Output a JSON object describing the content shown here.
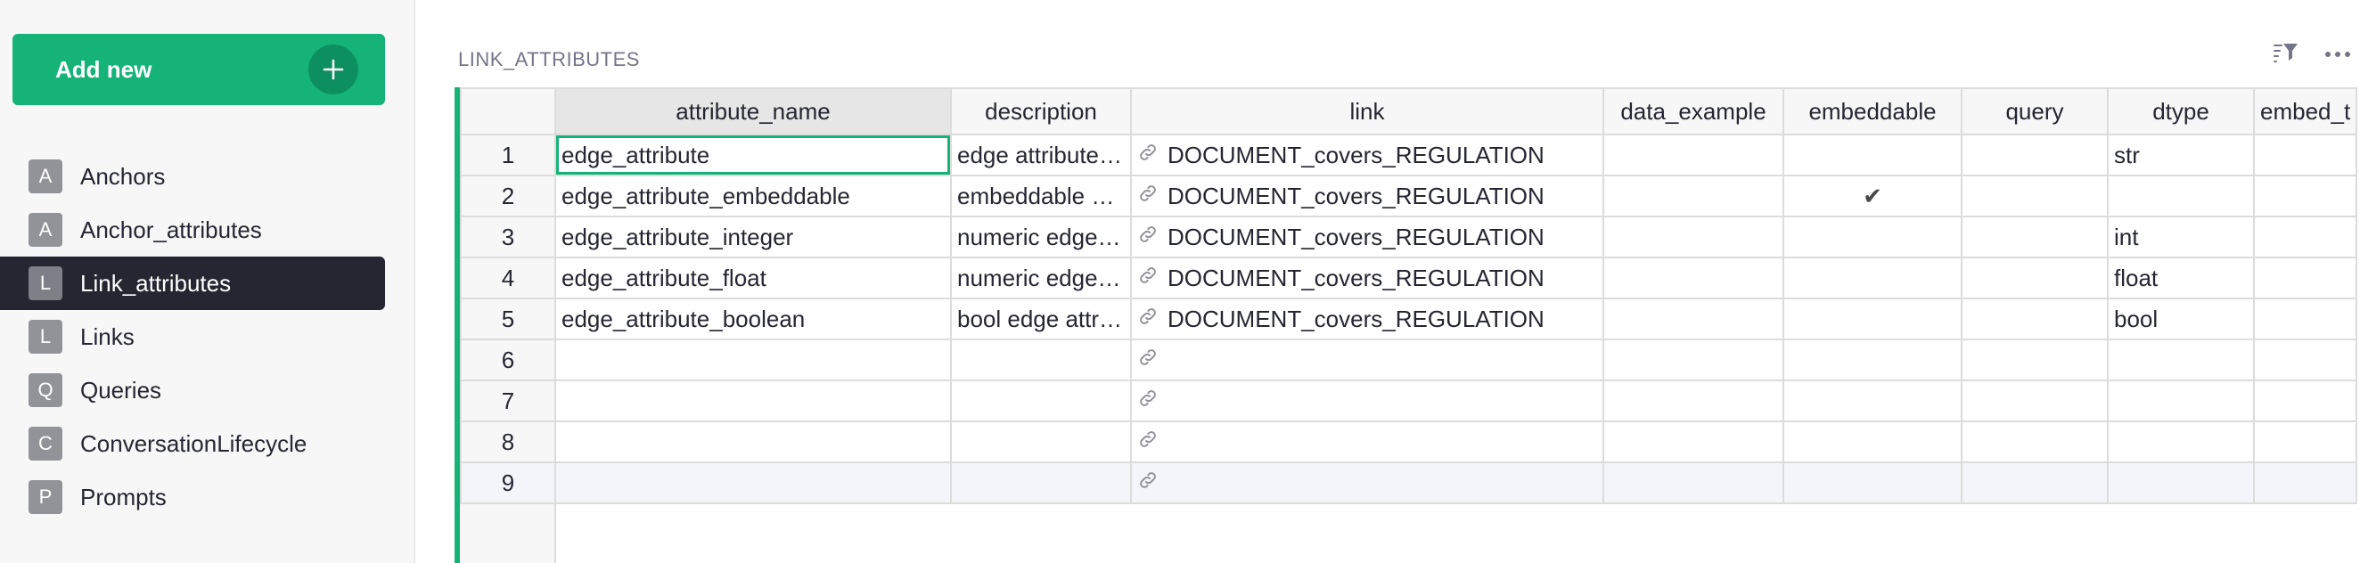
{
  "sidebar": {
    "add_button_label": "Add new",
    "items": [
      {
        "letter": "A",
        "label": "Anchors"
      },
      {
        "letter": "A",
        "label": "Anchor_attributes"
      },
      {
        "letter": "L",
        "label": "Link_attributes"
      },
      {
        "letter": "L",
        "label": "Links"
      },
      {
        "letter": "Q",
        "label": "Queries"
      },
      {
        "letter": "C",
        "label": "ConversationLifecycle"
      },
      {
        "letter": "P",
        "label": "Prompts"
      }
    ],
    "active_index": 2
  },
  "main": {
    "section_title": "LINK_ATTRIBUTES",
    "columns": [
      "attribute_name",
      "description",
      "link",
      "data_example",
      "embeddable",
      "query",
      "dtype",
      "embed_t"
    ],
    "rows": [
      {
        "num": "1",
        "attribute_name": "edge_attribute",
        "description": "edge attribute…",
        "link": "DOCUMENT_covers_REGULATION",
        "data_example": "",
        "embeddable": false,
        "query": "",
        "dtype": "str"
      },
      {
        "num": "2",
        "attribute_name": "edge_attribute_embeddable",
        "description": "embeddable …",
        "link": "DOCUMENT_covers_REGULATION",
        "data_example": "",
        "embeddable": true,
        "query": "",
        "dtype": ""
      },
      {
        "num": "3",
        "attribute_name": "edge_attribute_integer",
        "description": "numeric edge…",
        "link": "DOCUMENT_covers_REGULATION",
        "data_example": "",
        "embeddable": false,
        "query": "",
        "dtype": "int"
      },
      {
        "num": "4",
        "attribute_name": "edge_attribute_float",
        "description": "numeric edge…",
        "link": "DOCUMENT_covers_REGULATION",
        "data_example": "",
        "embeddable": false,
        "query": "",
        "dtype": "float"
      },
      {
        "num": "5",
        "attribute_name": "edge_attribute_boolean",
        "description": "bool edge attr…",
        "link": "DOCUMENT_covers_REGULATION",
        "data_example": "",
        "embeddable": false,
        "query": "",
        "dtype": "bool"
      },
      {
        "num": "6",
        "attribute_name": "",
        "description": "",
        "link": "",
        "data_example": "",
        "embeddable": false,
        "query": "",
        "dtype": ""
      },
      {
        "num": "7",
        "attribute_name": "",
        "description": "",
        "link": "",
        "data_example": "",
        "embeddable": false,
        "query": "",
        "dtype": ""
      },
      {
        "num": "8",
        "attribute_name": "",
        "description": "",
        "link": "",
        "data_example": "",
        "embeddable": false,
        "query": "",
        "dtype": ""
      },
      {
        "num": "9",
        "attribute_name": "",
        "description": "",
        "link": "",
        "data_example": "",
        "embeddable": false,
        "query": "",
        "dtype": ""
      }
    ]
  },
  "icons": {
    "add": "plus-icon",
    "sort_filter": "sort-filter-icon",
    "more": "more-options-icon",
    "link": "link-icon",
    "check": "checkmark-icon"
  },
  "colors": {
    "accent": "#16b378",
    "active_nav": "#262633",
    "badge": "#929299"
  }
}
